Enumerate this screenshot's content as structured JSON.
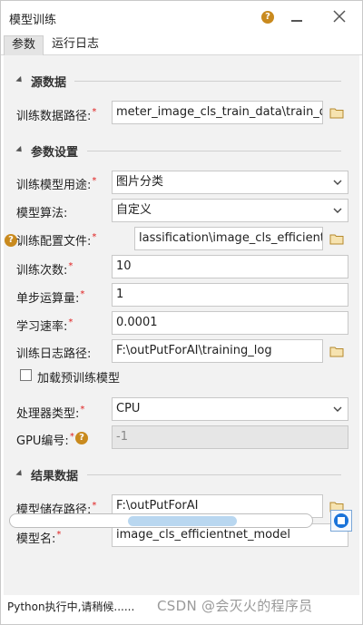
{
  "window": {
    "title": "模型训练",
    "help_icon": "?",
    "minimize_icon": "minimize-icon",
    "close_icon": "close-icon"
  },
  "tabs": [
    {
      "label": "参数",
      "active": true
    },
    {
      "label": "运行日志",
      "active": false
    }
  ],
  "sections": {
    "source": "源数据",
    "params": "参数设置",
    "result": "结果数据"
  },
  "fields": {
    "train_data_path": {
      "label": "训练数据路径:",
      "required": true,
      "value": "meter_image_cls_train_data\\train_data"
    },
    "model_usage": {
      "label": "训练模型用途:",
      "required": true,
      "value": "图片分类"
    },
    "model_algorithm": {
      "label": "模型算法:",
      "required": false,
      "value": "自定义"
    },
    "config_file": {
      "label": "训练配置文件:",
      "required": true,
      "value": "lassification\\image_cls_efficientnet.sdt"
    },
    "epochs": {
      "label": "训练次数:",
      "required": true,
      "value": "10"
    },
    "batch_size": {
      "label": "单步运算量:",
      "required": true,
      "value": "1"
    },
    "learning_rate": {
      "label": "学习速率:",
      "required": true,
      "value": "0.0001"
    },
    "log_path": {
      "label": "训练日志路径:",
      "required": false,
      "value": "F:\\outPutForAI\\training_log"
    },
    "pretrained": {
      "label": "加载预训练模型",
      "checked": false
    },
    "processor": {
      "label": "处理器类型:",
      "required": true,
      "value": "CPU"
    },
    "gpu_id": {
      "label": "GPU编号:",
      "required": true,
      "value": "-1"
    },
    "model_save_path": {
      "label": "模型储存路径:",
      "required": true,
      "value": "F:\\outPutForAI"
    },
    "model_name": {
      "label": "模型名:",
      "required": true,
      "value": "image_cls_efficientnet_model"
    }
  },
  "required_mark": "*",
  "progress": {
    "state": "indeterminate"
  },
  "status_text": "Python执行中,请稍候......",
  "watermark": "CSDN @会灭火的程序员",
  "colors": {
    "accent": "#1a73d9",
    "help": "#c98a1e",
    "required": "#e02020",
    "progress_fill": "#b9d7f0"
  }
}
